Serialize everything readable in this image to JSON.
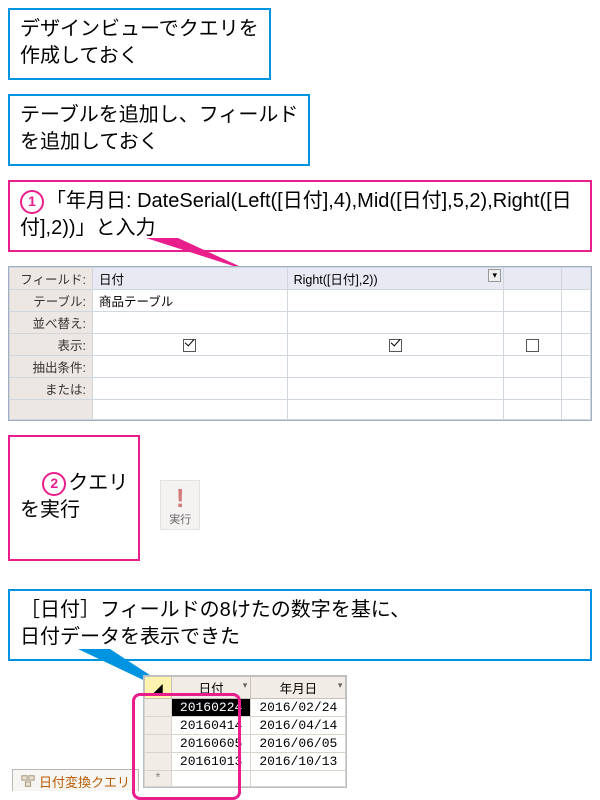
{
  "callouts": {
    "prep1": "デザインビューでクエリを\n作成しておく",
    "prep2": "テーブルを追加し、フィールド\nを追加しておく",
    "step1_num": "1",
    "step1_text": "「年月日: DateSerial(Left([日付],4),Mid([日付],5,2),Right([日付],2))」と入力",
    "step2_num": "2",
    "step2_text": "クエリ\nを実行",
    "result": "［日付］フィールドの8けたの数字を基に、\n日付データを表示できた"
  },
  "run_button": {
    "label": "実行"
  },
  "qbe": {
    "labels": {
      "field": "フィールド:",
      "table": "テーブル:",
      "sort": "並べ替え:",
      "show": "表示:",
      "criteria": "抽出条件:",
      "or": "または:"
    },
    "cols": [
      {
        "field": "日付",
        "table": "商品テーブル",
        "show": true
      },
      {
        "field": "Right([日付],2))",
        "table": "",
        "show": true
      },
      {
        "field": "",
        "table": "",
        "show": false
      }
    ]
  },
  "datasheet": {
    "tab": "日付変換クエリ",
    "headers": [
      "日付",
      "年月日"
    ],
    "rows": [
      {
        "c0": "20160224",
        "c1": "2016/02/24",
        "selected": true
      },
      {
        "c0": "20160414",
        "c1": "2016/04/14",
        "selected": false
      },
      {
        "c0": "20160605",
        "c1": "2016/06/05",
        "selected": false
      },
      {
        "c0": "20161013",
        "c1": "2016/10/13",
        "selected": false
      }
    ]
  }
}
